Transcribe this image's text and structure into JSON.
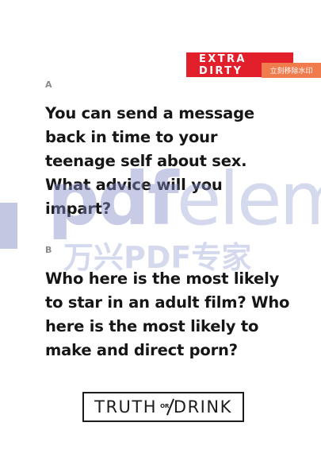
{
  "tag": {
    "label": "EXTRA DIRTY"
  },
  "watermark": {
    "badge_label": "立刻移除水印",
    "big_text_bold": "pdf",
    "big_text_light": "eleme",
    "cn_text": "万兴PDF专家"
  },
  "questions": [
    {
      "letter": "A",
      "text": "You can send a message\nback in time to your\nteenage self about sex.\nWhat advice will you\nimpart?"
    },
    {
      "letter": "B",
      "text": "Who here is the most likely\nto star in an adult film? Who\nhere is the most likely to\nmake and direct porn?"
    }
  ],
  "logo": {
    "left": "TRUTH",
    "or": "OR",
    "right": "DRINK"
  },
  "colors": {
    "tag": "#e2202b",
    "badge": "#f07b4d",
    "text": "#161616"
  }
}
